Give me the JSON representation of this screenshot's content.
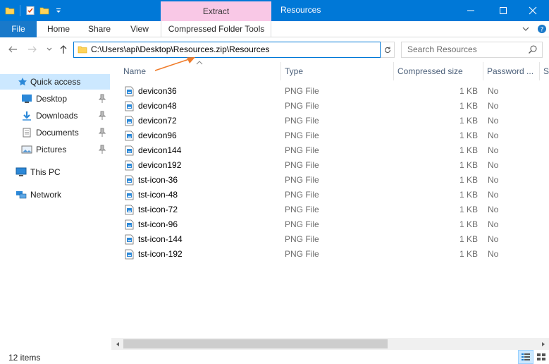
{
  "window": {
    "title": "Resources",
    "context_tab": "Extract",
    "colors": {
      "titlebar": "#0078d7",
      "context_tab": "#f9c8e6",
      "selection": "#cce8ff",
      "annotation_arrow": "#f07c2a"
    }
  },
  "ribbon": {
    "tabs": [
      "File",
      "Home",
      "Share",
      "View",
      "Compressed Folder Tools"
    ]
  },
  "navigation": {
    "address": "C:\\Users\\api\\Desktop\\Resources.zip\\Resources",
    "search_placeholder": "Search Resources"
  },
  "sidebar": {
    "quick_access": "Quick access",
    "items": [
      {
        "label": "Desktop",
        "icon": "desktop-icon",
        "pinned": true
      },
      {
        "label": "Downloads",
        "icon": "downloads-icon",
        "pinned": true
      },
      {
        "label": "Documents",
        "icon": "documents-icon",
        "pinned": true
      },
      {
        "label": "Pictures",
        "icon": "pictures-icon",
        "pinned": true
      }
    ],
    "this_pc": "This PC",
    "network": "Network"
  },
  "columns": {
    "name": "Name",
    "type": "Type",
    "compressed_size": "Compressed size",
    "password": "Password ...",
    "more": "S"
  },
  "files": [
    {
      "name": "devicon36",
      "type": "PNG File",
      "size": "1 KB",
      "password": "No"
    },
    {
      "name": "devicon48",
      "type": "PNG File",
      "size": "1 KB",
      "password": "No"
    },
    {
      "name": "devicon72",
      "type": "PNG File",
      "size": "1 KB",
      "password": "No"
    },
    {
      "name": "devicon96",
      "type": "PNG File",
      "size": "1 KB",
      "password": "No"
    },
    {
      "name": "devicon144",
      "type": "PNG File",
      "size": "1 KB",
      "password": "No"
    },
    {
      "name": "devicon192",
      "type": "PNG File",
      "size": "1 KB",
      "password": "No"
    },
    {
      "name": "tst-icon-36",
      "type": "PNG File",
      "size": "1 KB",
      "password": "No"
    },
    {
      "name": "tst-icon-48",
      "type": "PNG File",
      "size": "1 KB",
      "password": "No"
    },
    {
      "name": "tst-icon-72",
      "type": "PNG File",
      "size": "1 KB",
      "password": "No"
    },
    {
      "name": "tst-icon-96",
      "type": "PNG File",
      "size": "1 KB",
      "password": "No"
    },
    {
      "name": "tst-icon-144",
      "type": "PNG File",
      "size": "1 KB",
      "password": "No"
    },
    {
      "name": "tst-icon-192",
      "type": "PNG File",
      "size": "1 KB",
      "password": "No"
    }
  ],
  "status": {
    "item_count": "12 items"
  }
}
